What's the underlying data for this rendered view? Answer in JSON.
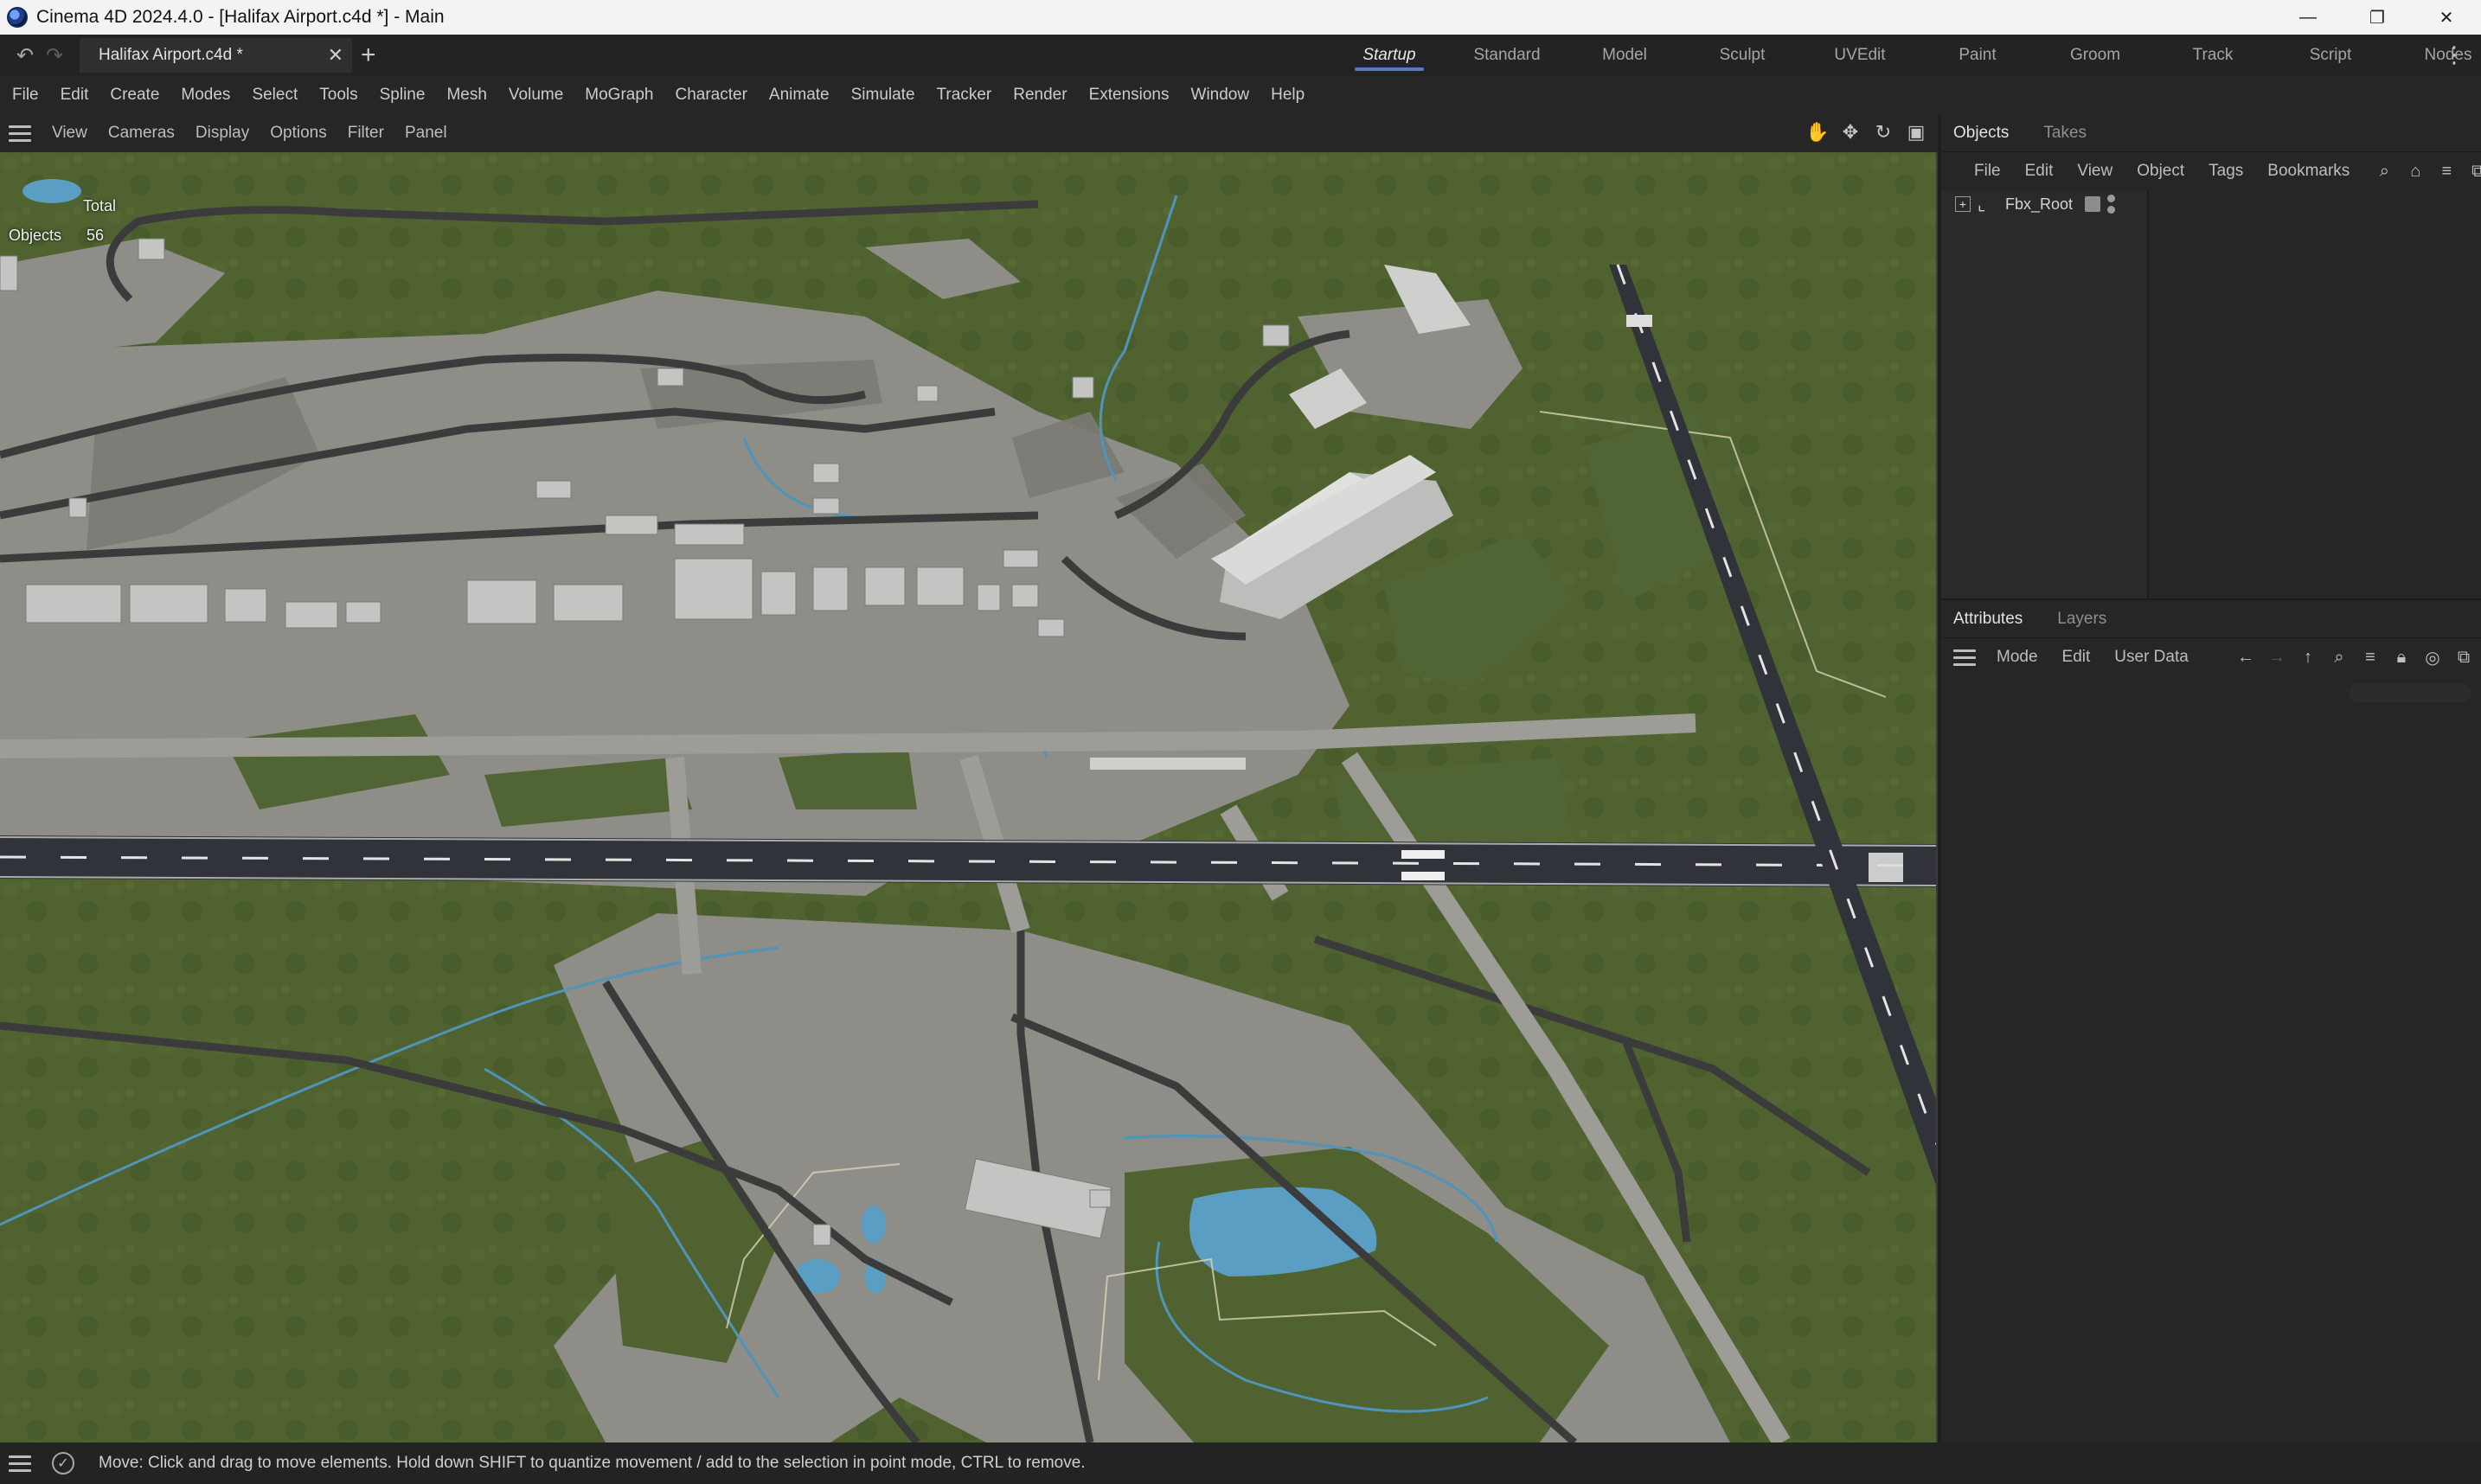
{
  "window": {
    "title": "Cinema 4D 2024.4.0 - [Halifax Airport.c4d *] - Main",
    "minimize": "—",
    "restore": "❐",
    "close": "✕"
  },
  "tabbar": {
    "undo_icon": "↶",
    "redo_icon": "↷",
    "document_tab": "Halifax Airport.c4d *",
    "tab_close": "✕",
    "add_tab": "+",
    "layouts": [
      "Startup",
      "Standard",
      "Model",
      "Sculpt",
      "UVEdit",
      "Paint",
      "Groom",
      "Track",
      "Script",
      "Nodes"
    ],
    "active_layout": "Startup",
    "more_icon": "⋮"
  },
  "main_menu": [
    "File",
    "Edit",
    "Create",
    "Modes",
    "Select",
    "Tools",
    "Spline",
    "Mesh",
    "Volume",
    "MoGraph",
    "Character",
    "Animate",
    "Simulate",
    "Tracker",
    "Render",
    "Extensions",
    "Window",
    "Help"
  ],
  "viewport": {
    "menu": [
      "View",
      "Cameras",
      "Display",
      "Options",
      "Filter",
      "Panel"
    ],
    "icons": [
      "move-view-icon",
      "dolly-icon",
      "rotate-view-icon",
      "maximize-view-icon"
    ],
    "hud": {
      "total_label": "Total",
      "objects_label": "Objects",
      "objects_value": "56"
    }
  },
  "objects_panel": {
    "tabs": [
      "Objects",
      "Takes"
    ],
    "menu": [
      "File",
      "Edit",
      "View",
      "Object",
      "Tags",
      "Bookmarks"
    ],
    "tree": [
      {
        "name": "Fbx_Root",
        "expand": "+",
        "icon": "null-object-icon"
      }
    ]
  },
  "attributes_panel": {
    "tabs": [
      "Attributes",
      "Layers"
    ],
    "menu": [
      "Mode",
      "Edit",
      "User Data"
    ]
  },
  "statusbar": {
    "message": "Move: Click and drag to move elements. Hold down SHIFT to quantize movement / add to the selection in point mode, CTRL to remove."
  },
  "colors": {
    "accent": "#5b78c8",
    "grass": "#4d5f2b",
    "concrete": "#8a8a86",
    "water": "#5a9ec4"
  }
}
